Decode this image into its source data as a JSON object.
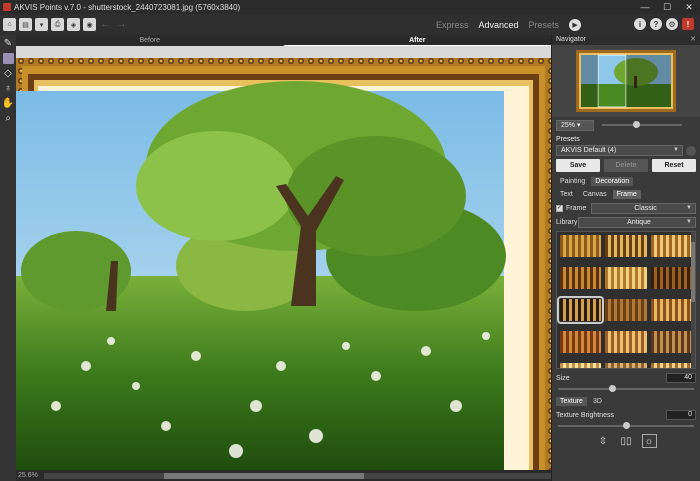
{
  "window": {
    "title": "AKVIS Points v.7.0 - shutterstock_2440723081.jpg (5760x3840)",
    "controls": [
      "—",
      "☐",
      "✕"
    ]
  },
  "toolbar": {
    "modes": [
      "Express",
      "Advanced",
      "Presets"
    ],
    "active_mode": "Advanced",
    "icons": [
      "home-icon",
      "open-icon",
      "save-icon",
      "print-icon",
      "batch-icon",
      "share-icon",
      "undo-icon",
      "redo-icon"
    ]
  },
  "tools": [
    "brush-icon",
    "rectangle-select-icon",
    "eraser-icon",
    "stamp-icon",
    "hand-icon",
    "zoom-icon"
  ],
  "canvas": {
    "tab_before": "Before",
    "tab_after": "After",
    "active_tab": "After",
    "zoom_status": "25.6%"
  },
  "navigator": {
    "title": "Navigator",
    "zoom": "25%",
    "zoom_slider": 0.42
  },
  "presets": {
    "title": "Presets",
    "selected": "AKVIS Default (4)",
    "save_label": "Save",
    "delete_label": "Delete",
    "reset_label": "Reset"
  },
  "main_tabs": [
    "Painting",
    "Decoration"
  ],
  "active_main_tab": "Decoration",
  "sub_tabs": [
    "Text",
    "Canvas",
    "Frame"
  ],
  "active_sub_tab": "Frame",
  "frame": {
    "checkbox_label": "Frame",
    "checked": true,
    "type": "Classic",
    "library_label": "Library",
    "library": "Antique",
    "selected_index": 6
  },
  "params": {
    "size_label": "Size",
    "size_value": "40",
    "size_slider": 0.4,
    "texture_tab": "Texture",
    "threed_tab": "3D",
    "texture_brightness_label": "Texture Brightness",
    "texture_brightness_value": "0",
    "brightness_slider": 0.5
  },
  "colors": {
    "frame_gold": "#c8902a",
    "frame_dark": "#4a2a0c",
    "sky": "#8fc7ea",
    "grass": "#3f7a1e"
  }
}
